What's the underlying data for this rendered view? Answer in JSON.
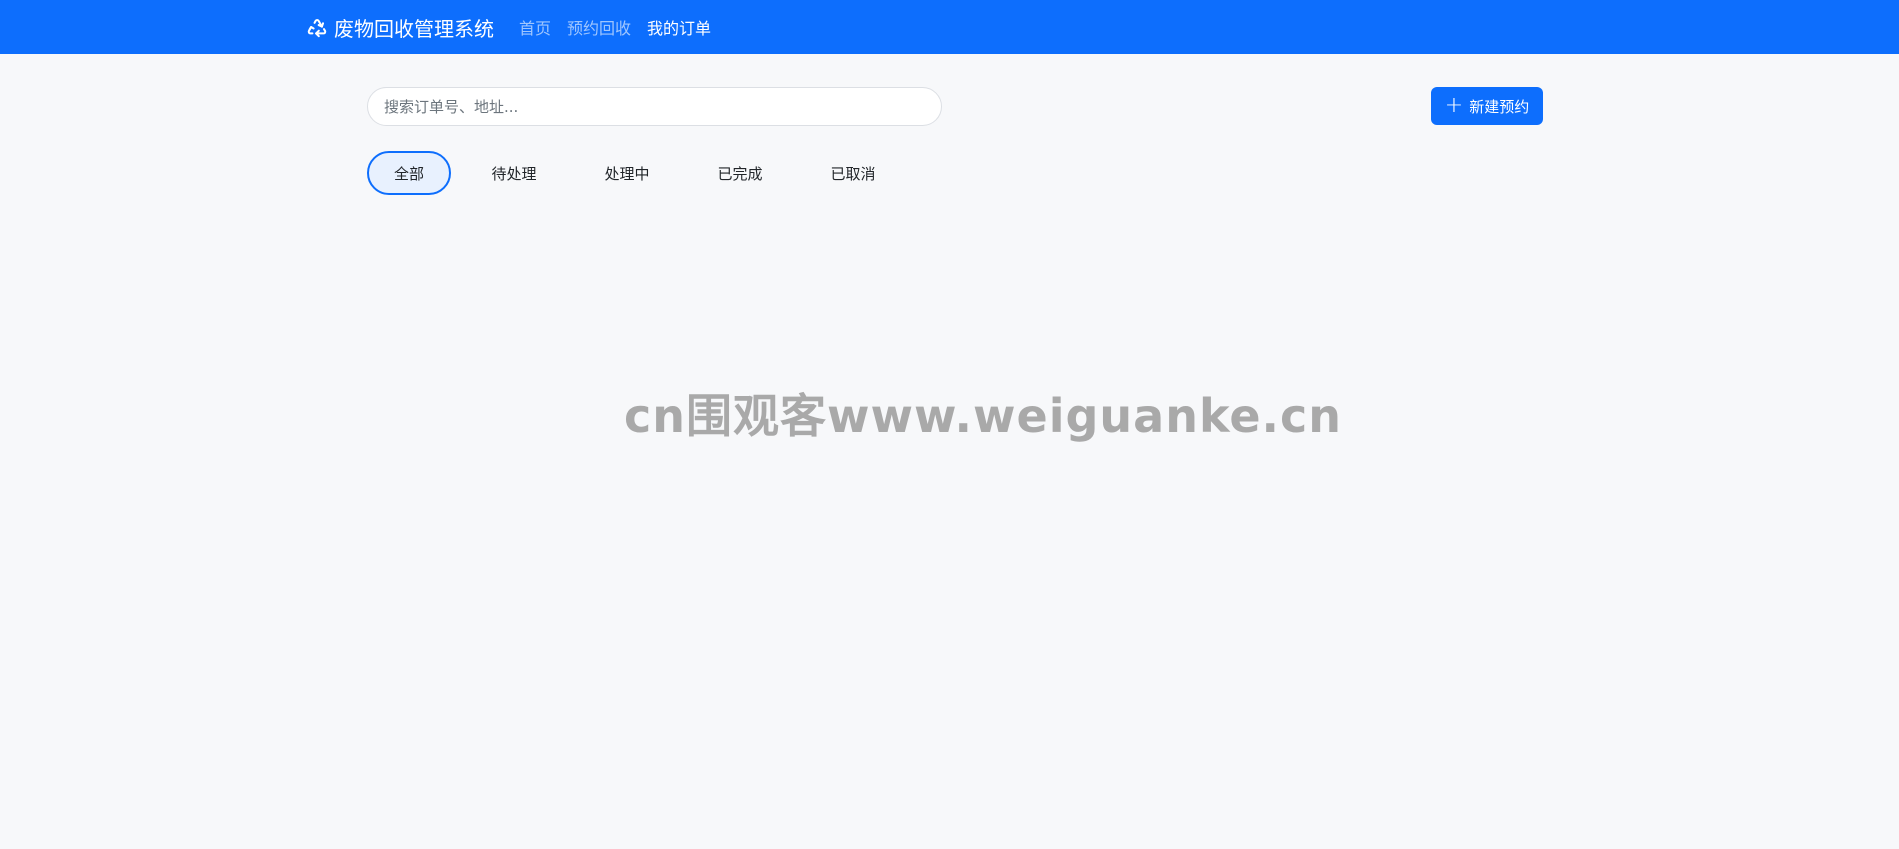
{
  "navbar": {
    "brand": {
      "icon": "recycle-icon",
      "title": "废物回收管理系统"
    },
    "links": [
      {
        "label": "首页",
        "active": false
      },
      {
        "label": "预约回收",
        "active": false
      },
      {
        "label": "我的订单",
        "active": true
      }
    ]
  },
  "search": {
    "placeholder": "搜索订单号、地址...",
    "value": ""
  },
  "new_button": {
    "icon": "plus-icon",
    "label": "新建预约"
  },
  "tabs": [
    {
      "label": "全部",
      "active": true
    },
    {
      "label": "待处理",
      "active": false
    },
    {
      "label": "处理中",
      "active": false
    },
    {
      "label": "已完成",
      "active": false
    },
    {
      "label": "已取消",
      "active": false
    }
  ],
  "watermark": "cn围观客www.weiguanke.cn",
  "colors": {
    "primary": "#0d6efd",
    "background": "#f7f8fa"
  }
}
